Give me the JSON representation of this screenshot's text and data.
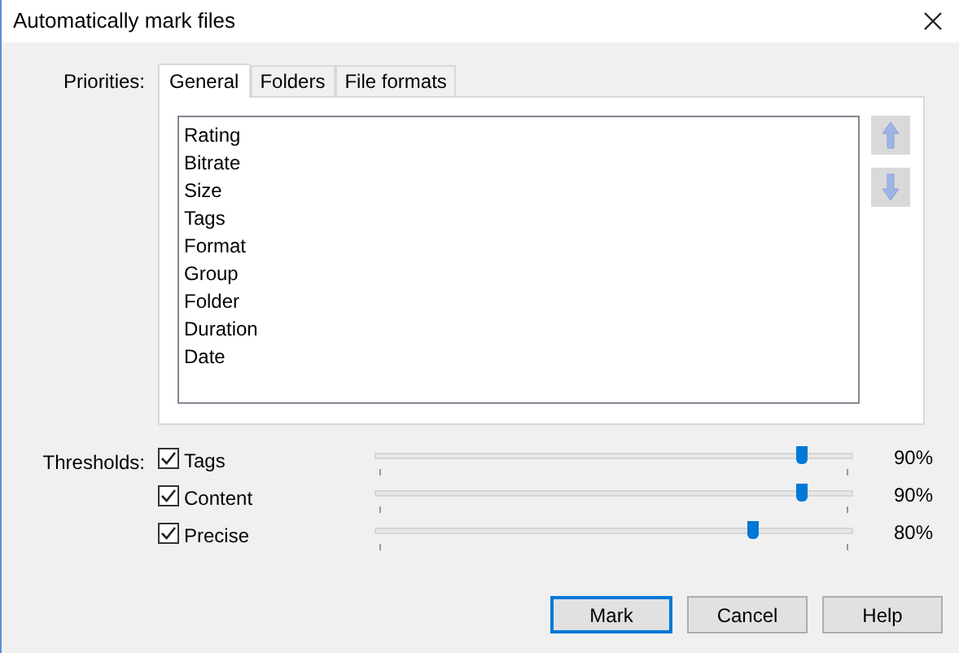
{
  "window": {
    "title": "Automatically mark files"
  },
  "priorities": {
    "label": "Priorities:",
    "tabs": [
      {
        "label": "General",
        "selected": true
      },
      {
        "label": "Folders",
        "selected": false
      },
      {
        "label": "File formats",
        "selected": false
      }
    ],
    "items": [
      "Rating",
      "Bitrate",
      "Size",
      "Tags",
      "Format",
      "Group",
      "Folder",
      "Duration",
      "Date"
    ]
  },
  "thresholds": {
    "label": "Thresholds:",
    "rows": [
      {
        "name": "Tags",
        "checked": true,
        "level": 0.89,
        "reading": "90%"
      },
      {
        "name": "Content",
        "checked": true,
        "level": 0.89,
        "reading": "90%"
      },
      {
        "name": "Precise",
        "checked": true,
        "level": 0.79,
        "reading": "80%"
      }
    ]
  },
  "buttons": [
    {
      "label": "Mark",
      "default": true
    },
    {
      "label": "Cancel",
      "default": false
    },
    {
      "label": "Help",
      "default": false
    }
  ]
}
